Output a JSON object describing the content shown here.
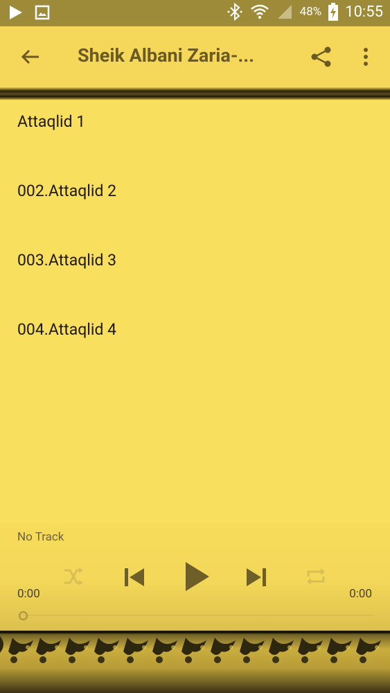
{
  "status_bar": {
    "battery_percent": "48%",
    "time": "10:55"
  },
  "app_bar": {
    "title": "Sheik Albani Zaria-..."
  },
  "tracks": [
    {
      "label": "Attaqlid 1"
    },
    {
      "label": "002.Attaqlid 2"
    },
    {
      "label": "003.Attaqlid 3"
    },
    {
      "label": "004.Attaqlid 4"
    }
  ],
  "player": {
    "now_playing": "No Track",
    "elapsed": "0:00",
    "duration": "0:00",
    "progress": 0
  },
  "colors": {
    "app_bar": "#f5d85a",
    "background": "#f9df5e",
    "icon": "#6b5a23",
    "status_bar": "#9e8b39"
  },
  "icons": [
    "play-store-icon",
    "image-icon",
    "bluetooth-icon",
    "wifi-icon",
    "signal-icon",
    "battery-charging-icon",
    "back-arrow-icon",
    "share-icon",
    "more-vert-icon",
    "shuffle-icon",
    "skip-previous-icon",
    "play-icon",
    "skip-next-icon",
    "repeat-icon"
  ]
}
